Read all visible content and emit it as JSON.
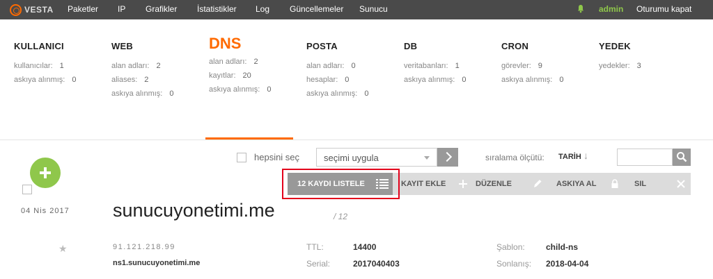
{
  "topbar": {
    "logo": "VESTA",
    "nav": [
      "Paketler",
      "IP",
      "Grafikler",
      "İstatistikler",
      "Log",
      "Güncellemeler",
      "Sunucu"
    ],
    "user": "admin",
    "logout": "Oturumu kapat"
  },
  "panels": [
    {
      "title": "KULLANICI",
      "stats": [
        {
          "k": "kullanıcılar:",
          "v": "1"
        },
        {
          "k": "askıya alınmış:",
          "v": "0"
        }
      ]
    },
    {
      "title": "WEB",
      "stats": [
        {
          "k": "alan adları:",
          "v": "2"
        },
        {
          "k": "aliases:",
          "v": "2"
        },
        {
          "k": "askıya alınmış:",
          "v": "0"
        }
      ]
    },
    {
      "title": "DNS",
      "stats": [
        {
          "k": "alan adları:",
          "v": "2"
        },
        {
          "k": "kayıtlar:",
          "v": "20"
        },
        {
          "k": "askıya alınmış:",
          "v": "0"
        }
      ]
    },
    {
      "title": "POSTA",
      "stats": [
        {
          "k": "alan adları:",
          "v": "0"
        },
        {
          "k": "hesaplar:",
          "v": "0"
        },
        {
          "k": "askıya alınmış:",
          "v": "0"
        }
      ]
    },
    {
      "title": "DB",
      "stats": [
        {
          "k": "veritabanları:",
          "v": "1"
        },
        {
          "k": "askıya alınmış:",
          "v": "0"
        }
      ]
    },
    {
      "title": "CRON",
      "stats": [
        {
          "k": "görevler:",
          "v": "9"
        },
        {
          "k": "askıya alınmış:",
          "v": "0"
        }
      ]
    },
    {
      "title": "YEDEK",
      "stats": [
        {
          "k": "yedekler:",
          "v": "3"
        }
      ]
    }
  ],
  "active_panel": "DNS",
  "toolbar": {
    "select_all": "hepsini seç",
    "apply": "seçimi uygula",
    "sort_label": "sıralama ölçütü:",
    "sort_value": "TARİH",
    "sort_arrow": "↓",
    "search_placeholder": ""
  },
  "actions": {
    "list": "12 KAYDI LISTELE",
    "add": "KAYIT EKLE",
    "edit": "DÜZENLE",
    "suspend": "ASKIYA AL",
    "delete": "SIL"
  },
  "record": {
    "date": "04  Nis  2017",
    "domain": "sunucuyonetimi.me",
    "count": "/ 12",
    "ip": "91.121.218.99",
    "ns": "ns1.sunucuyonetimi.me",
    "ttl_label": "TTL:",
    "ttl": "14400",
    "serial_label": "Serial:",
    "serial": "2017040403",
    "template_label": "Şablon:",
    "template": "child-ns",
    "expire_label": "Sonlanış:",
    "expire": "2018-04-04"
  },
  "colors": {
    "accent": "#ff6a00",
    "green": "#8fc74b",
    "topbar": "#4a4a4a",
    "highlight": "#e3001b"
  }
}
